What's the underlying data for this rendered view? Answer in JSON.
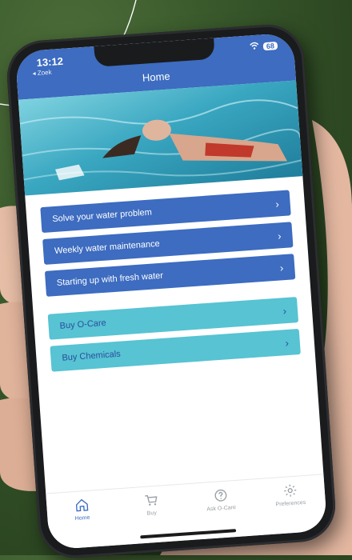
{
  "status": {
    "time": "13:12",
    "back": "◂ Zoek",
    "battery": "68"
  },
  "header": {
    "title": "Home"
  },
  "menu": {
    "items": [
      {
        "label": "Solve your water problem",
        "style": "blue"
      },
      {
        "label": "Weekly water maintenance",
        "style": "blue"
      },
      {
        "label": "Starting up with fresh water",
        "style": "blue"
      }
    ],
    "shop": [
      {
        "label": "Buy O-Care",
        "style": "teal"
      },
      {
        "label": "Buy Chemicals",
        "style": "teal"
      }
    ]
  },
  "tabs": [
    {
      "label": "Home",
      "icon": "home-icon",
      "active": true
    },
    {
      "label": "Buy",
      "icon": "cart-icon"
    },
    {
      "label": "Ask O-Care",
      "icon": "question-icon"
    },
    {
      "label": "Preferences",
      "icon": "gear-icon"
    }
  ],
  "colors": {
    "primary": "#3d6cc0",
    "accent": "#57c3d3"
  }
}
